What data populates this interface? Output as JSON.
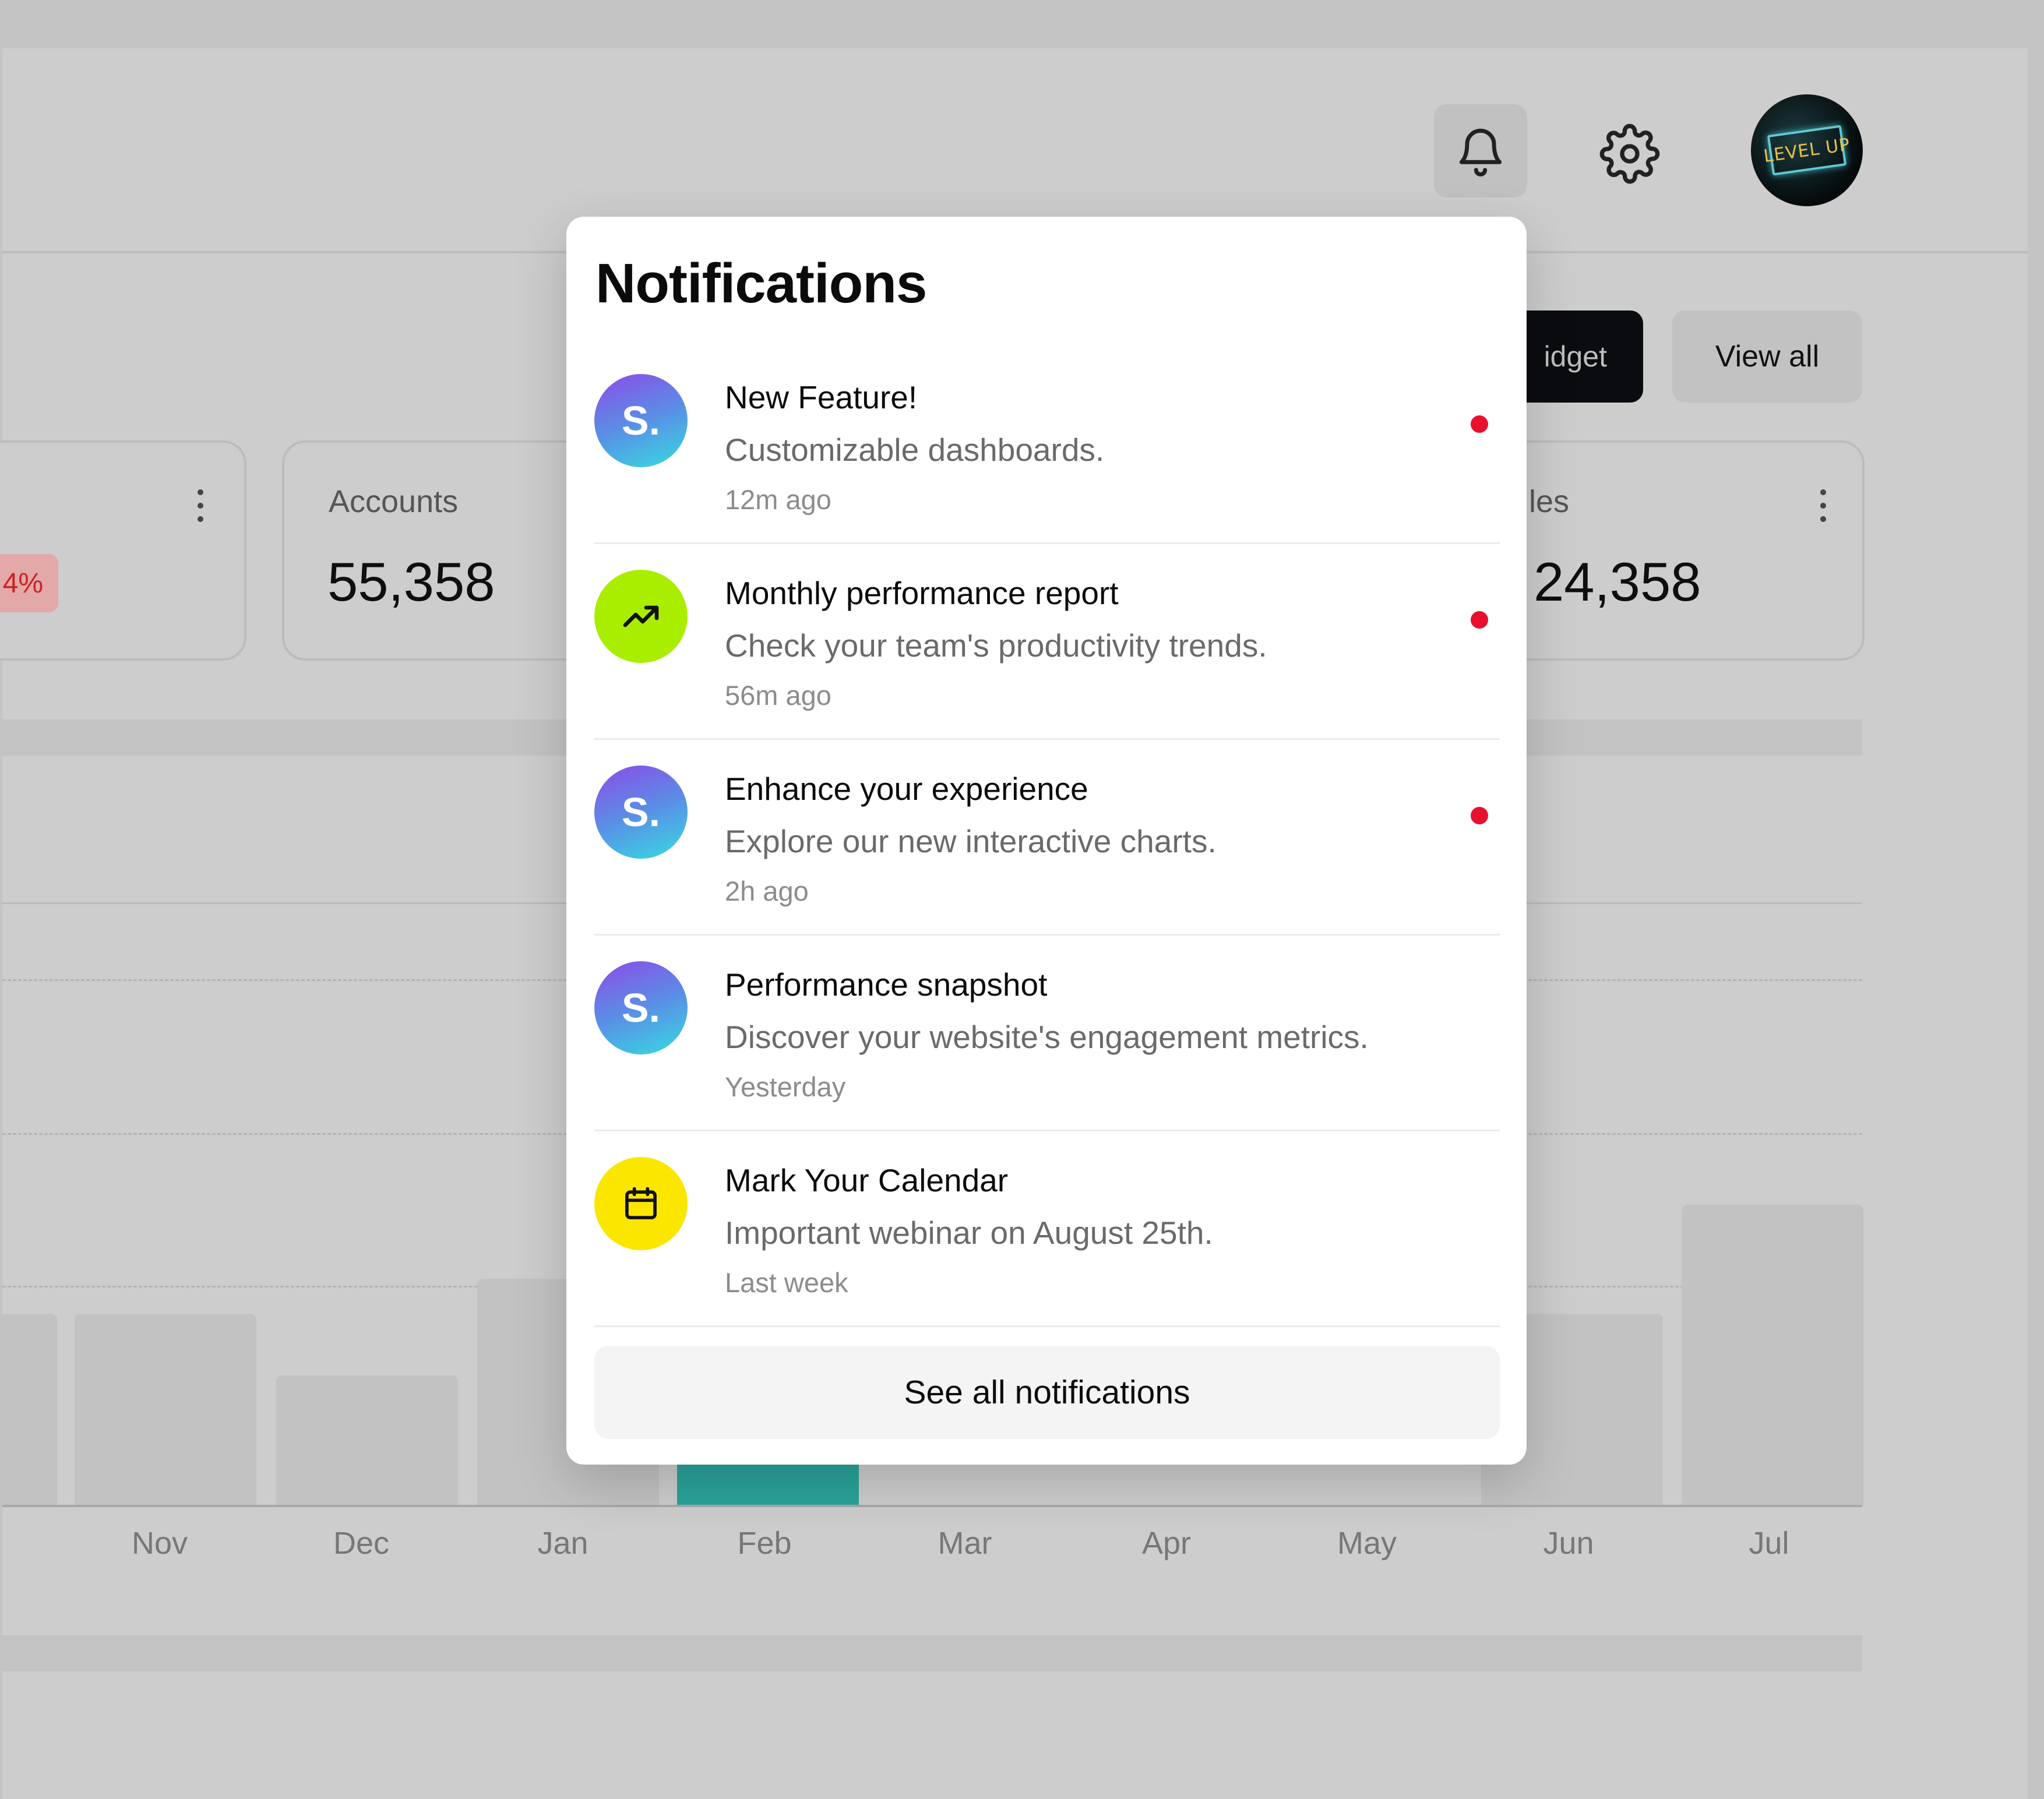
{
  "header": {
    "avatar_text": "LEVEL UP",
    "bell_icon": "bell-icon",
    "settings_icon": "gear-icon"
  },
  "toolbar": {
    "widget_button_label": "idget",
    "view_all_label": "View all"
  },
  "stats": {
    "left_card_badge": "4%",
    "accounts_label": "Accounts",
    "accounts_value": "55,358",
    "right_card_label": "les",
    "right_card_value": "24,358"
  },
  "chart": {
    "months": [
      "Nov",
      "Dec",
      "Jan",
      "Feb",
      "Mar",
      "Apr",
      "May",
      "Jun",
      "Jul"
    ],
    "highlighted_month": "Feb"
  },
  "notifications": {
    "title": "Notifications",
    "items": [
      {
        "icon": "S.",
        "icon_type": "letter",
        "title": "New Feature!",
        "description": "Customizable dashboards.",
        "time": "12m ago",
        "unread": true
      },
      {
        "icon": "trending-up-icon",
        "icon_type": "trend",
        "title": "Monthly performance report",
        "description": "Check your team's productivity trends.",
        "time": "56m ago",
        "unread": true
      },
      {
        "icon": "S.",
        "icon_type": "letter",
        "title": "Enhance your experience",
        "description": "Explore our new interactive charts.",
        "time": "2h ago",
        "unread": true
      },
      {
        "icon": "S.",
        "icon_type": "letter",
        "title": "Performance snapshot",
        "description": "Discover your website's engagement metrics.",
        "time": "Yesterday",
        "unread": false
      },
      {
        "icon": "calendar-icon",
        "icon_type": "calendar",
        "title": "Mark Your Calendar",
        "description": "Important webinar on August 25th.",
        "time": "Last week",
        "unread": false
      }
    ],
    "see_all_label": "See all notifications"
  },
  "colors": {
    "unread_dot": "#e8102e",
    "trend_icon_bg": "#a9ee00",
    "calendar_icon_bg": "#fbe600",
    "active_bar": "#2aa39a"
  }
}
